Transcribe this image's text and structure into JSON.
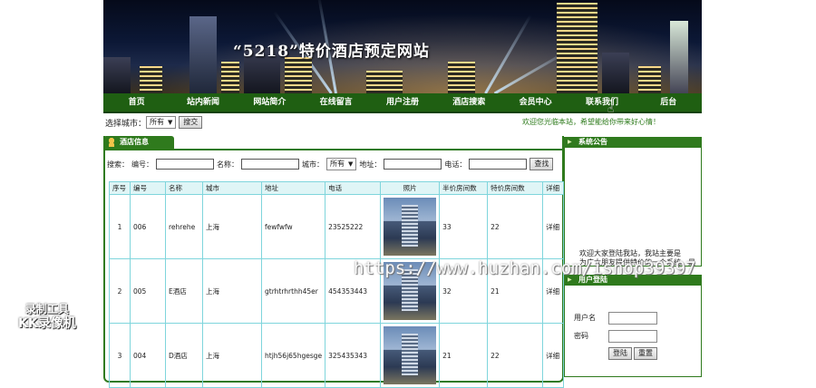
{
  "banner": {
    "title": "“5218”特价酒店预定网站"
  },
  "nav": [
    "首页",
    "站内新闻",
    "网站简介",
    "在线留言",
    "用户注册",
    "酒店搜索",
    "会员中心",
    "联系我们",
    "后台"
  ],
  "city_bar": {
    "label": "选择城市：",
    "selected": "所有",
    "button": "搜交",
    "marquee": "欢迎您光临本站，希望能给你带来好心情！"
  },
  "hotel_panel": {
    "tab": "酒店信息",
    "search": {
      "prefix": "搜索：",
      "code_label": "编号：",
      "name_label": "名称：",
      "city_label": "城市：",
      "city_selected": "所有",
      "address_label": "地址：",
      "phone_label": "电话：",
      "button": "查找"
    },
    "columns": [
      "序号",
      "编号",
      "名称",
      "城市",
      "地址",
      "电话",
      "照片",
      "半价房间数",
      "特价房间数",
      "详细"
    ],
    "rows": [
      {
        "no": "1",
        "code": "006",
        "name": "rehrehe",
        "city": "上海",
        "address": "fewfwfw",
        "phone": "23525222",
        "half": "33",
        "special": "22",
        "detail": "详细"
      },
      {
        "no": "2",
        "code": "005",
        "name": "E酒店",
        "city": "上海",
        "address": "gtrhtrhrthh45er",
        "phone": "454353443",
        "half": "32",
        "special": "21",
        "detail": "详细"
      },
      {
        "no": "3",
        "code": "004",
        "name": "D酒店",
        "city": "上海",
        "address": "htjh56j65hgesge",
        "phone": "325435343",
        "half": "21",
        "special": "22",
        "detail": "详细"
      }
    ]
  },
  "sidebar": {
    "notice_title": "系统公告",
    "notice_text_1": "欢迎大家登陆我站，我站主要是",
    "notice_text_2": "为广大朋友提供特价的一个系统。最",
    "login_title": "用户登陆",
    "username_label": "用户名",
    "password_label": "密码",
    "login_button": "登陆",
    "reset_button": "重置"
  },
  "watermark": "https://www.huzhan.com/ishop39397",
  "recorder": {
    "line1": "录制工具",
    "line2": "KK录像机"
  }
}
